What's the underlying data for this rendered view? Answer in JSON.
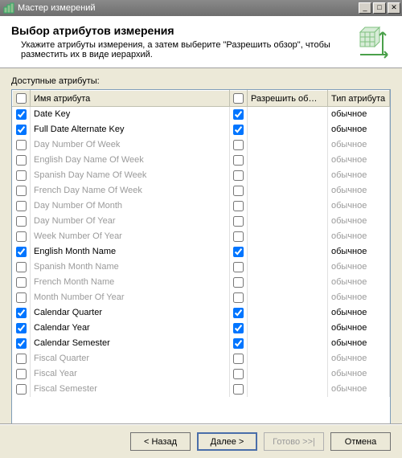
{
  "window": {
    "title": "Мастер измерений"
  },
  "header": {
    "title": "Выбор атрибутов измерения",
    "subtitle": "Укажите атрибуты измерения, а затем выберите \"Разрешить обзор\", чтобы разместить их в виде иерархий."
  },
  "section_label": "Доступные атрибуты:",
  "columns": {
    "name": "Имя атрибута",
    "browse": "Разрешить об…",
    "type": "Тип атрибута"
  },
  "type_value": "обычное",
  "rows": [
    {
      "checked": true,
      "name": "Date Key",
      "browse": true,
      "enabled": true
    },
    {
      "checked": true,
      "name": "Full Date Alternate Key",
      "browse": true,
      "enabled": true
    },
    {
      "checked": false,
      "name": "Day Number Of Week",
      "browse": false,
      "enabled": false
    },
    {
      "checked": false,
      "name": "English Day Name Of Week",
      "browse": false,
      "enabled": false
    },
    {
      "checked": false,
      "name": "Spanish Day Name Of Week",
      "browse": false,
      "enabled": false
    },
    {
      "checked": false,
      "name": "French Day Name Of Week",
      "browse": false,
      "enabled": false
    },
    {
      "checked": false,
      "name": "Day Number Of Month",
      "browse": false,
      "enabled": false
    },
    {
      "checked": false,
      "name": "Day Number Of Year",
      "browse": false,
      "enabled": false
    },
    {
      "checked": false,
      "name": "Week Number Of Year",
      "browse": false,
      "enabled": false
    },
    {
      "checked": true,
      "name": "English Month Name",
      "browse": true,
      "enabled": true
    },
    {
      "checked": false,
      "name": "Spanish Month Name",
      "browse": false,
      "enabled": false
    },
    {
      "checked": false,
      "name": "French Month Name",
      "browse": false,
      "enabled": false
    },
    {
      "checked": false,
      "name": "Month Number Of Year",
      "browse": false,
      "enabled": false
    },
    {
      "checked": true,
      "name": "Calendar Quarter",
      "browse": true,
      "enabled": true
    },
    {
      "checked": true,
      "name": "Calendar Year",
      "browse": true,
      "enabled": true
    },
    {
      "checked": true,
      "name": "Calendar Semester",
      "browse": true,
      "enabled": true
    },
    {
      "checked": false,
      "name": "Fiscal Quarter",
      "browse": false,
      "enabled": false
    },
    {
      "checked": false,
      "name": "Fiscal Year",
      "browse": false,
      "enabled": false
    },
    {
      "checked": false,
      "name": "Fiscal Semester",
      "browse": false,
      "enabled": false
    }
  ],
  "buttons": {
    "back": "< Назад",
    "next": "Далее >",
    "finish": "Готово >>|",
    "cancel": "Отмена"
  }
}
